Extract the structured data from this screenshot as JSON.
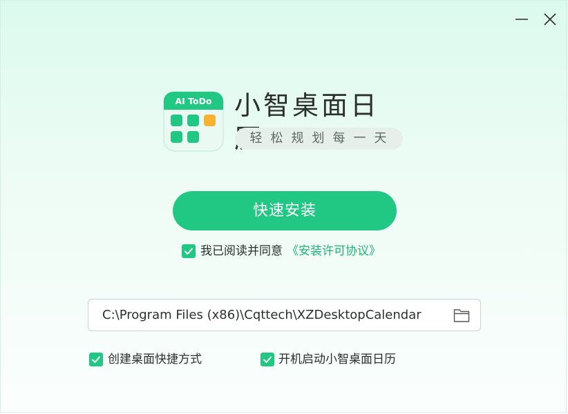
{
  "window": {
    "minimize_icon": "minimize-icon",
    "close_icon": "close-icon"
  },
  "app": {
    "logo_badge": "AI ToDo",
    "title": "小智桌面日历",
    "slogan": "轻松规划每一天"
  },
  "install_button": {
    "label": "快速安装"
  },
  "agreement": {
    "checked": true,
    "text": "我已阅读并同意",
    "link": "《安装许可协议》"
  },
  "install_path": {
    "value": "C:\\Program Files (x86)\\Cqttech\\XZDesktopCalendar",
    "browse_icon": "folder-icon"
  },
  "options": [
    {
      "label": "创建桌面快捷方式",
      "checked": true
    },
    {
      "label": "开机启动小智桌面日历",
      "checked": true
    }
  ],
  "colors": {
    "accent": "#20c884",
    "link": "#1fb377",
    "orange_tile": "#f7b232"
  }
}
